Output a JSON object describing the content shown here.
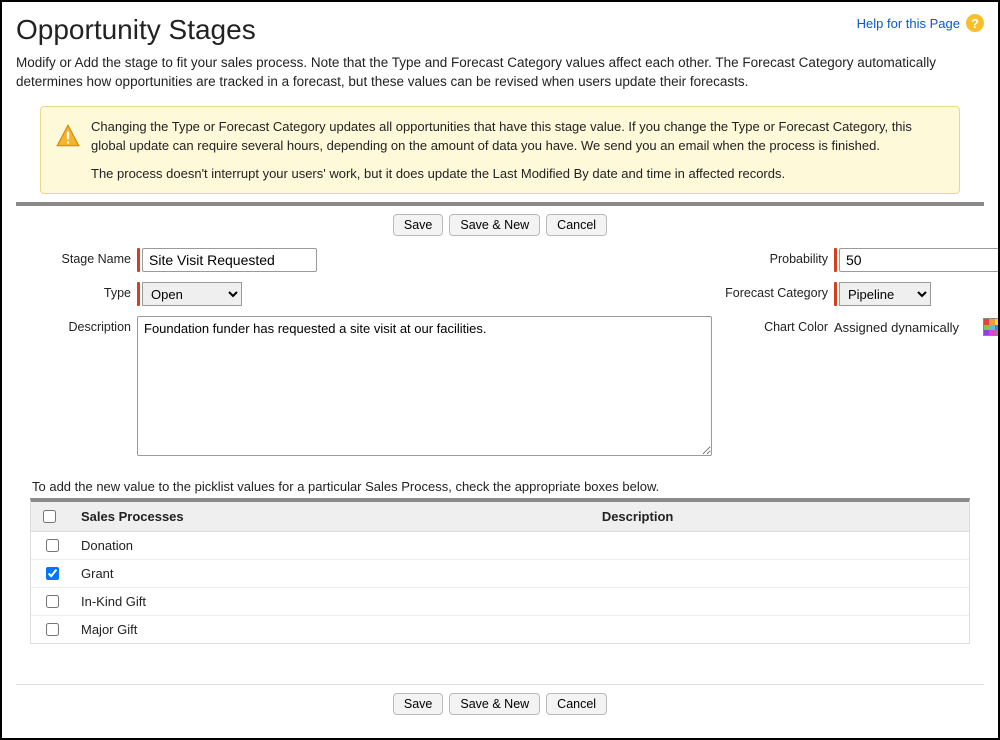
{
  "header": {
    "title": "Opportunity Stages",
    "help_text": "Help for this Page"
  },
  "intro": "Modify or Add the stage to fit your sales process. Note that the Type and Forecast Category values affect each other. The Forecast Category automatically determines how opportunities are tracked in a forecast, but these values can be revised when users update their forecasts.",
  "callout": {
    "p1": "Changing the Type or Forecast Category updates all opportunities that have this stage value. If you change the Type or Forecast Category, this global update can require several hours, depending on the amount of data you have. We send you an email when the process is finished.",
    "p2": "The process doesn't interrupt your users' work, but it does update the Last Modified By date and time in affected records."
  },
  "buttons": {
    "save": "Save",
    "save_new": "Save & New",
    "cancel": "Cancel"
  },
  "labels": {
    "stage_name": "Stage Name",
    "type": "Type",
    "description": "Description",
    "probability": "Probability",
    "forecast_category": "Forecast Category",
    "chart_color": "Chart Color"
  },
  "values": {
    "stage_name": "Site Visit Requested",
    "type": "Open",
    "description": "Foundation funder has requested a site visit at our facilities.",
    "probability": "50",
    "forecast_category": "Pipeline",
    "chart_color_text": "Assigned dynamically"
  },
  "picklist": {
    "intro": "To add the new value to the picklist values for a particular Sales Process, check the appropriate boxes below.",
    "col_sales_processes": "Sales Processes",
    "col_description": "Description",
    "rows": [
      {
        "label": "Donation",
        "checked": false
      },
      {
        "label": "Grant",
        "checked": true
      },
      {
        "label": "In-Kind Gift",
        "checked": false
      },
      {
        "label": "Major Gift",
        "checked": false
      }
    ]
  }
}
